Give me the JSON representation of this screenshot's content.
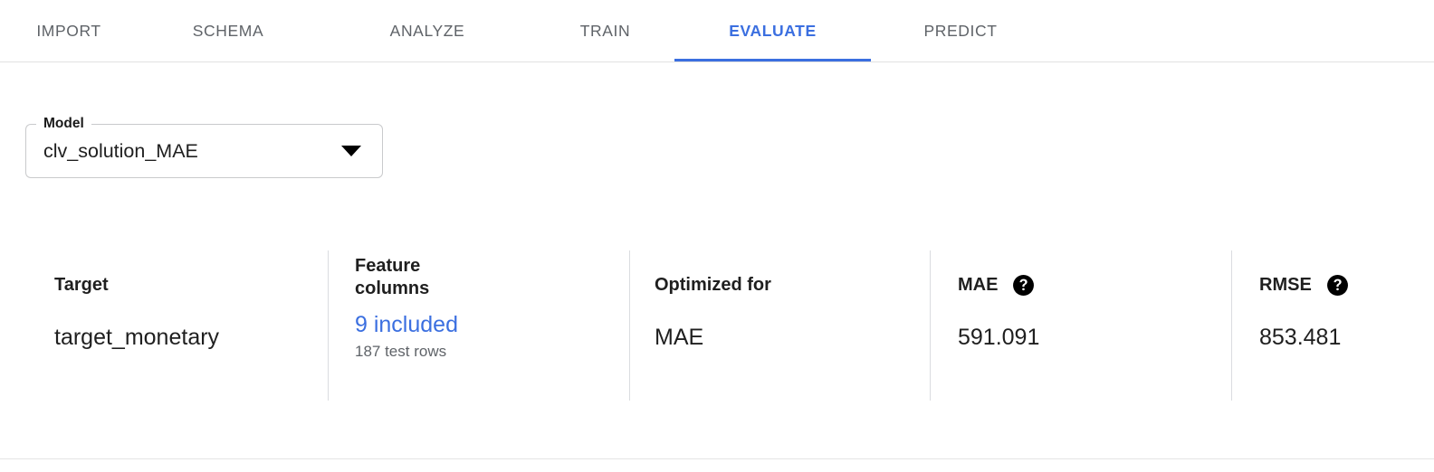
{
  "tabs": [
    {
      "id": "import",
      "label": "IMPORT",
      "active": false
    },
    {
      "id": "schema",
      "label": "SCHEMA",
      "active": false
    },
    {
      "id": "analyze",
      "label": "ANALYZE",
      "active": false
    },
    {
      "id": "train",
      "label": "TRAIN",
      "active": false
    },
    {
      "id": "evaluate",
      "label": "EVALUATE",
      "active": true
    },
    {
      "id": "predict",
      "label": "PREDICT",
      "active": false
    }
  ],
  "model_select": {
    "label": "Model",
    "value": "clv_solution_MAE",
    "arrow_icon": "chevron-down-icon"
  },
  "metrics": {
    "target": {
      "label": "Target",
      "value": "target_monetary"
    },
    "feature_columns": {
      "label": "Feature columns",
      "value": "9 included",
      "sub": "187 test rows"
    },
    "optimized_for": {
      "label": "Optimized for",
      "value": "MAE"
    },
    "mae": {
      "label": "MAE",
      "value": "591.091",
      "help_icon": "help-icon"
    },
    "rmse": {
      "label": "RMSE",
      "value": "853.481",
      "help_icon": "help-icon"
    }
  },
  "colors": {
    "accent": "#3b6fe0",
    "label_text": "#1f1f1f",
    "muted_text": "#5f6368",
    "divider": "#dadce0",
    "outline": "#c9cacc"
  }
}
